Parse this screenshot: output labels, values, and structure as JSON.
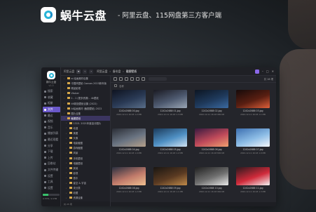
{
  "header": {
    "title": "蜗牛云盘",
    "subtitle": "- 阿里云盘、115网盘第三方客户端"
  },
  "app": {
    "sidebar": {
      "name": "蜗牛云盘",
      "version": "v1.0",
      "items": [
        {
          "label": "搜索"
        },
        {
          "label": "收藏"
        },
        {
          "label": "相册"
        },
        {
          "label": "文件",
          "active": true
        },
        {
          "label": "最近"
        },
        {
          "label": "视频"
        },
        {
          "label": "音乐"
        },
        {
          "label": "播放列表"
        },
        {
          "label": "最近观看"
        },
        {
          "label": "分享"
        },
        {
          "label": "下载"
        },
        {
          "label": "上传"
        },
        {
          "label": "回收站"
        },
        {
          "label": "文件传输"
        },
        {
          "label": "设置"
        },
        {
          "label": "工具"
        },
        {
          "label": "设置"
        }
      ],
      "quota": "0.5TB / 2.0TB",
      "quota_fraction": 0.35
    },
    "topbar": {
      "label": "阿里云盘",
      "breadcrumbs": [
        "阿里云盘",
        "备份盘",
        "截图壁纸"
      ]
    },
    "tree": {
      "rows": [
        {
          "label": "ai 绘画素材合集",
          "level": 0
        },
        {
          "label": "中国风壁纸 Canvas 2023新年版",
          "level": 0
        },
        {
          "label": "精品影视",
          "level": 0
        },
        {
          "label": "Vtuber",
          "level": 0
        },
        {
          "label": "1 - 1  (更多资源) - 4k壁纸",
          "level": 0
        },
        {
          "label": "4K精选壁纸合集 (2022)",
          "level": 0
        },
        {
          "label": "AI绘画素材 (截图壁纸) 2022",
          "level": 0
        },
        {
          "label": "图片合集",
          "level": 0
        },
        {
          "label": "截图壁纸",
          "level": 0,
          "selected": true
        },
        {
          "label": "1315. 2021年度高分图片",
          "level": 1
        },
        {
          "label": "动漫",
          "level": 1
        },
        {
          "label": "美图",
          "level": 1
        },
        {
          "label": "头像",
          "level": 1
        },
        {
          "label": "电影截图",
          "level": 1
        },
        {
          "label": "游戏截图",
          "level": 1
        },
        {
          "label": "风景",
          "level": 1
        },
        {
          "label": "手机壁纸",
          "level": 1
        },
        {
          "label": "电脑壁纸",
          "level": 1
        },
        {
          "label": "其他",
          "level": 1
        },
        {
          "label": "影视",
          "level": 1
        },
        {
          "label": "音乐",
          "level": 1
        },
        {
          "label": "星空 & 宇宙",
          "level": 1
        },
        {
          "label": "未分类",
          "level": 1
        },
        {
          "label": "收藏",
          "level": 1
        },
        {
          "label": "资源合集",
          "level": 1
        }
      ],
      "status": "共 25 项"
    },
    "grid": {
      "header": "名称",
      "count": "共 16 项",
      "items": [
        {
          "name": "1242x2688 00.jpg",
          "meta": "2022-12-11 16:18  1.2 MB",
          "colors": [
            "#0e1320",
            "#2a3a55",
            "#5a6f8a"
          ]
        },
        {
          "name": "1242x2688 01.jpg",
          "meta": "2022-12-11 16:18  1.3 MB",
          "colors": [
            "#1a1a22",
            "#4e5a70",
            "#9aa6b5"
          ]
        },
        {
          "name": "1242x2688 02.jpg",
          "meta": "2022-12-11 16:18  980 KB",
          "colors": [
            "#0c1522",
            "#1f3a5c",
            "#3b6aa1"
          ]
        },
        {
          "name": "1242x2688 03.jpg",
          "meta": "2022-12-11 16:18  1.1 MB",
          "colors": [
            "#160a0a",
            "#5a1f12",
            "#e0603a"
          ]
        },
        {
          "name": "1242x2688 04.jpg",
          "meta": "2022-12-11 16:18  1.4 MB",
          "colors": [
            "#2a2d35",
            "#6a7482",
            "#b5a08a"
          ]
        },
        {
          "name": "1242x2688 05.jpg",
          "meta": "2022-12-11 16:18  1.2 MB",
          "colors": [
            "#1b3a5a",
            "#4f90c4",
            "#cfe2f2"
          ]
        },
        {
          "name": "1242x2688 06.jpg",
          "meta": "2022-12-11 16:18  890 KB",
          "colors": [
            "#3a1a40",
            "#c04a5a",
            "#f0a070"
          ]
        },
        {
          "name": "1242x2688 07.jpg",
          "meta": "2022-12-11 16:18  1.0 MB",
          "colors": [
            "#3c6fb0",
            "#8dbde6",
            "#f4f6fa"
          ]
        },
        {
          "name": "1242x2688 08.jpg",
          "meta": "2022-12-11 16:18  1.2 MB",
          "colors": [
            "#2a3040",
            "#c07a6a",
            "#f0c090"
          ]
        },
        {
          "name": "1242x2688 09.jpg",
          "meta": "2022-12-11 16:18  1.1 MB",
          "colors": [
            "#1a1612",
            "#5a3a22",
            "#c08a4a"
          ]
        },
        {
          "name": "1242x2688 10.jpg",
          "meta": "2022-12-11 16:18  960 KB",
          "colors": [
            "#202020",
            "#707070",
            "#e8e8e8"
          ]
        },
        {
          "name": "1242x2688 11.jpg",
          "meta": "2022-12-11 16:18  1.3 MB",
          "colors": [
            "#2a1a1e",
            "#d02a3a",
            "#f4f4f4"
          ]
        }
      ]
    },
    "accent": "#6a58c9"
  }
}
